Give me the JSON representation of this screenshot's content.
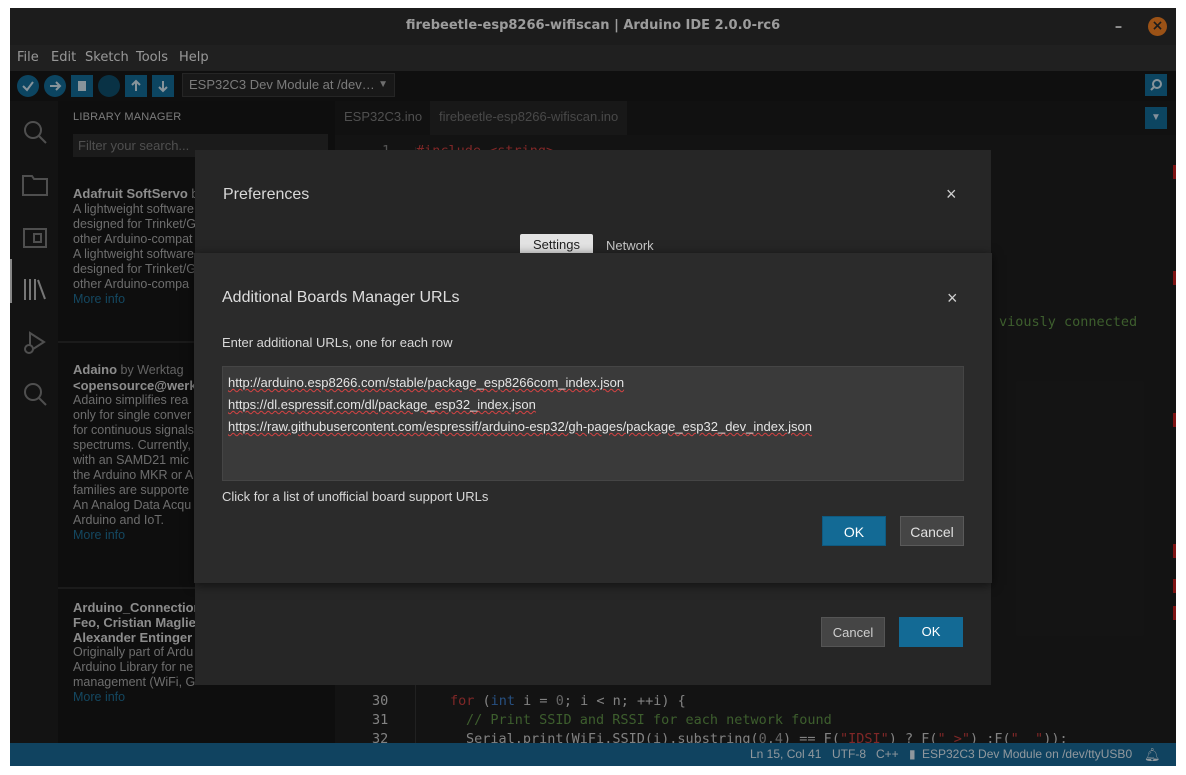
{
  "window": {
    "title": "firebeetle-esp8266-wifiscan | Arduino IDE 2.0.0-rc6",
    "minimize": "–",
    "close": "×"
  },
  "menu": [
    "File",
    "Edit",
    "Sketch",
    "Tools",
    "Help"
  ],
  "toolbar": {
    "board_select": "ESP32C3 Dev Module at /dev…"
  },
  "sidebar": {
    "icons": [
      "search-icon",
      "folder-icon",
      "board-icon",
      "library-icon",
      "debug-icon",
      "search-icon"
    ]
  },
  "library_manager": {
    "title": "LIBRARY MANAGER",
    "search_placeholder": "Filter your search...",
    "items": [
      {
        "title": "Adafruit SoftServo",
        "by": "b",
        "lines": [
          "A lightweight software",
          "designed for Trinket/G",
          "other Arduino-compat",
          "A lightweight software",
          "designed for Trinket/G",
          "other Arduino-compa"
        ],
        "more": "More info"
      },
      {
        "title": "Adaino",
        "by": "by Werktag",
        "line2": "<opensource@werk",
        "lines": [
          "Adaino simplifies rea",
          "only for single conver",
          "for continuous signals",
          "spectrums. Currently,",
          "with an SAMD21 mic",
          "the Arduino MKR or A",
          "families are supporte",
          "An Analog Data Acqu",
          "Arduino and IoT."
        ],
        "more": "More info"
      },
      {
        "title": "Arduino_Connection",
        "line2": "Feo, Cristian Maglie",
        "line3": "Alexander Entinger",
        "lines": [
          "Originally part of Ardu",
          "Arduino Library for ne",
          "management (WiFi, G"
        ],
        "more": "More info"
      }
    ]
  },
  "editor": {
    "tabs": [
      "ESP32C3.ino",
      "firebeetle-esp8266-wifiscan.ino"
    ],
    "line1_num": "1",
    "line1_code": "#include <string>",
    "fragment": "viously connected",
    "lines": [
      {
        "num": "30"
      },
      {
        "num": "31"
      },
      {
        "num": "32"
      }
    ]
  },
  "status": {
    "position": "Ln 15, Col 41",
    "encoding": "UTF-8",
    "language": "C++",
    "board": "ESP32C3 Dev Module on /dev/ttyUSB0"
  },
  "preferences": {
    "title": "Preferences",
    "tabs": {
      "settings": "Settings",
      "network": "Network"
    },
    "cancel": "Cancel",
    "ok": "OK"
  },
  "urls_dialog": {
    "title": "Additional Boards Manager URLs",
    "description": "Enter additional URLs, one for each row",
    "urls": [
      "http://arduino.esp8266.com/stable/package_esp8266com_index.json",
      "https://dl.espressif.com/dl/package_esp32_index.json",
      "https://raw.githubusercontent.com/espressif/arduino-esp32/gh-pages/package_esp32_dev_index.json"
    ],
    "link": "Click for a list of unofficial board support URLs",
    "ok": "OK",
    "cancel": "Cancel"
  }
}
